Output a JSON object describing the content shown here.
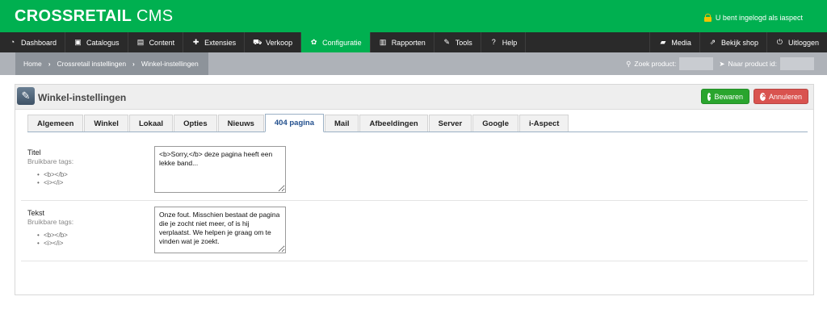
{
  "header": {
    "brand_bold": "CROSSRETAIL",
    "brand_light": "CMS",
    "login_text": "U bent ingelogd als iaspect"
  },
  "nav": {
    "left": [
      {
        "label": "Dashboard",
        "icon": "dashboard-icon"
      },
      {
        "label": "Catalogus",
        "icon": "basket-icon"
      },
      {
        "label": "Content",
        "icon": "content-icon"
      },
      {
        "label": "Extensies",
        "icon": "puzzle-icon"
      },
      {
        "label": "Verkoop",
        "icon": "cart-icon"
      },
      {
        "label": "Configuratie",
        "icon": "gear-icon",
        "active": true
      },
      {
        "label": "Rapporten",
        "icon": "bar-chart-icon"
      },
      {
        "label": "Tools",
        "icon": "wrench-icon"
      },
      {
        "label": "Help",
        "icon": "question-icon"
      }
    ],
    "right": [
      {
        "label": "Media",
        "icon": "folder-icon"
      },
      {
        "label": "Bekijk shop",
        "icon": "external-link-icon"
      },
      {
        "label": "Uitloggen",
        "icon": "power-icon"
      }
    ]
  },
  "breadcrumb": [
    "Home",
    "Crossretail instellingen",
    "Winkel-instellingen"
  ],
  "search": {
    "product_label": "Zoek product:",
    "product_value": "",
    "goto_label": "Naar product id:",
    "goto_value": ""
  },
  "panel": {
    "title": "Winkel-instellingen",
    "save_label": "Bewaren",
    "cancel_label": "Annuleren"
  },
  "tabs": [
    {
      "label": "Algemeen"
    },
    {
      "label": "Winkel"
    },
    {
      "label": "Lokaal"
    },
    {
      "label": "Opties"
    },
    {
      "label": "Nieuws"
    },
    {
      "label": "404 pagina",
      "active": true
    },
    {
      "label": "Mail"
    },
    {
      "label": "Afbeeldingen"
    },
    {
      "label": "Server"
    },
    {
      "label": "Google"
    },
    {
      "label": "i-Aspect"
    }
  ],
  "fields": [
    {
      "label": "Titel",
      "hint": "Bruikbare tags:",
      "tags": [
        "<b></b>",
        "<i></i>"
      ],
      "value": "<b>Sorry,</b> deze pagina heeft een lekke band..."
    },
    {
      "label": "Tekst",
      "hint": "Bruikbare tags:",
      "tags": [
        "<b></b>",
        "<i></i>"
      ],
      "value": "Onze fout. Misschien bestaat de pagina die je zocht niet meer, of is hij verplaatst. We helpen je graag om te vinden wat je zoekt."
    }
  ],
  "colors": {
    "brand_green": "#00b050",
    "nav_bg": "#2a2a2a",
    "save_button": "#2aa52e",
    "cancel_button": "#d9534f",
    "active_tab_text": "#23508e"
  }
}
